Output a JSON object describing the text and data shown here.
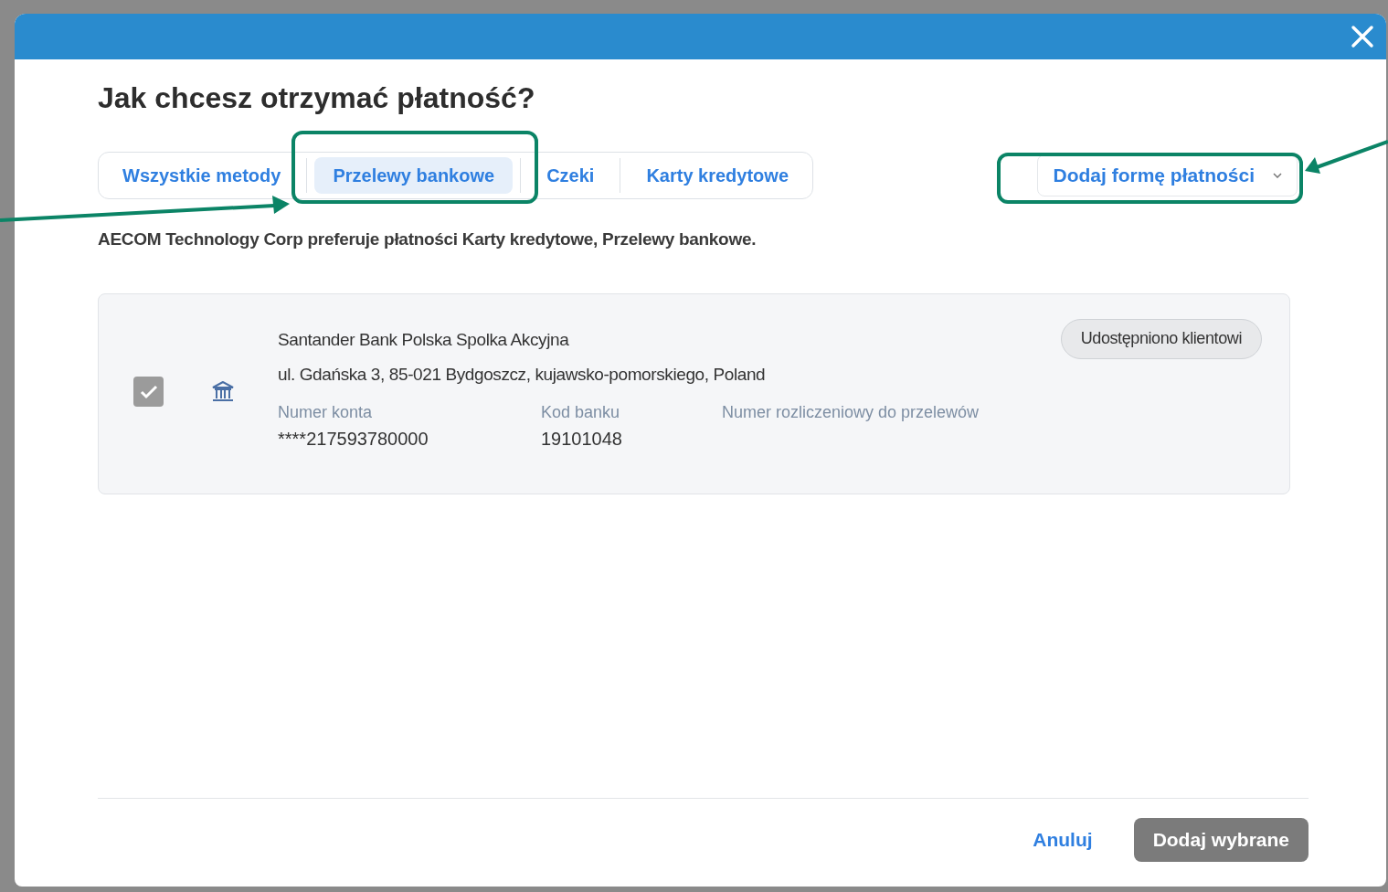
{
  "dialog": {
    "title": "Jak chcesz otrzymać płatność?"
  },
  "tabs": [
    {
      "label": "Wszystkie metody",
      "selected": false
    },
    {
      "label": "Przelewy bankowe",
      "selected": true
    },
    {
      "label": "Czeki",
      "selected": false
    },
    {
      "label": "Karty kredytowe",
      "selected": false
    }
  ],
  "add_method": {
    "label": "Dodaj formę płatności"
  },
  "preference_note": "AECOM Technology Corp preferuje płatności Karty kredytowe, Przelewy bankowe.",
  "accounts": [
    {
      "checked": true,
      "bank_name": "Santander Bank Polska Spolka Akcyjna",
      "address": "ul. Gdańska 3, 85-021 Bydgoszcz, kujawsko-pomorskiego, Poland",
      "badge": "Udostępniono klientowi",
      "fields": [
        {
          "label": "Numer konta",
          "value": "****217593780000"
        },
        {
          "label": "Kod banku",
          "value": "19101048"
        },
        {
          "label": "Numer rozliczeniowy do przelewów"
        }
      ]
    }
  ],
  "footer": {
    "cancel": "Anuluj",
    "submit": {
      "label": "Dodaj wybrane",
      "disabled": true
    }
  },
  "annotations": {
    "tab_frame": true,
    "add_frame": true
  }
}
